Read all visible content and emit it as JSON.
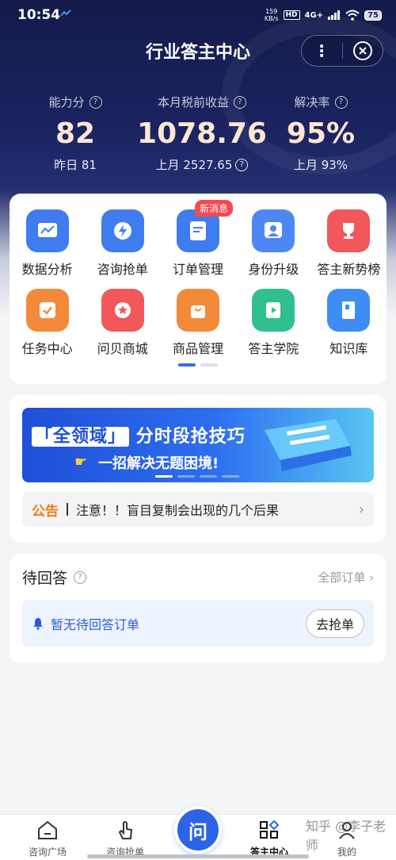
{
  "status_bar": {
    "time": "10:54",
    "speed_value": "159",
    "speed_unit": "KB/s",
    "hd": "HD",
    "signal": "4G+",
    "battery": "75"
  },
  "header": {
    "title": "行业答主中心",
    "more_icon": "more-dots-icon",
    "close_icon": "close-circle-icon"
  },
  "stats": [
    {
      "label": "能力分",
      "value": "82",
      "sub": "昨日 81"
    },
    {
      "label": "本月税前收益",
      "value": "1078.76",
      "sub": "上月 2527.65"
    },
    {
      "label": "解决率",
      "value": "95%",
      "sub": "上月 93%"
    }
  ],
  "grid": {
    "items": [
      {
        "label": "数据分析",
        "icon": "chart-icon",
        "color": "#3f7cf0"
      },
      {
        "label": "咨询抢单",
        "icon": "lightning-icon",
        "color": "#3f7cf0"
      },
      {
        "label": "订单管理",
        "icon": "document-icon",
        "color": "#3f7cf0",
        "badge": "新消息"
      },
      {
        "label": "身份升级",
        "icon": "user-badge-icon",
        "color": "#4f86f5"
      },
      {
        "label": "答主新势榜",
        "icon": "trophy-icon",
        "color": "#f1575b"
      },
      {
        "label": "任务中心",
        "icon": "checkbox-icon",
        "color": "#f28a3a"
      },
      {
        "label": "问贝商城",
        "icon": "shop-icon",
        "color": "#f1575b"
      },
      {
        "label": "商品管理",
        "icon": "shopping-bag-icon",
        "color": "#f28a3a"
      },
      {
        "label": "答主学院",
        "icon": "play-book-icon",
        "color": "#2fc08e"
      },
      {
        "label": "知识库",
        "icon": "book-icon",
        "color": "#3f8cf5"
      }
    ]
  },
  "banner": {
    "highlight": "「全领域」",
    "line1": "分时段抢技巧",
    "line2": "一招解决无题困境!"
  },
  "notice": {
    "tag": "公告",
    "text": "注意！！盲目复制会出现的几个后果"
  },
  "pending": {
    "title": "待回答",
    "all_orders": "全部订单",
    "empty_text": "暂无待回答订单",
    "grab_button": "去抢单"
  },
  "tabbar": {
    "tabs": [
      {
        "label": "咨询广场",
        "icon": "home-icon"
      },
      {
        "label": "咨询抢单",
        "icon": "hand-tap-icon"
      },
      {
        "label": "问",
        "icon": "center-ask-button"
      },
      {
        "label": "答主中心",
        "icon": "grid-diamond-icon",
        "active": true
      },
      {
        "label": "我的",
        "icon": "person-icon"
      }
    ]
  },
  "watermark": "知乎 @李子老师"
}
